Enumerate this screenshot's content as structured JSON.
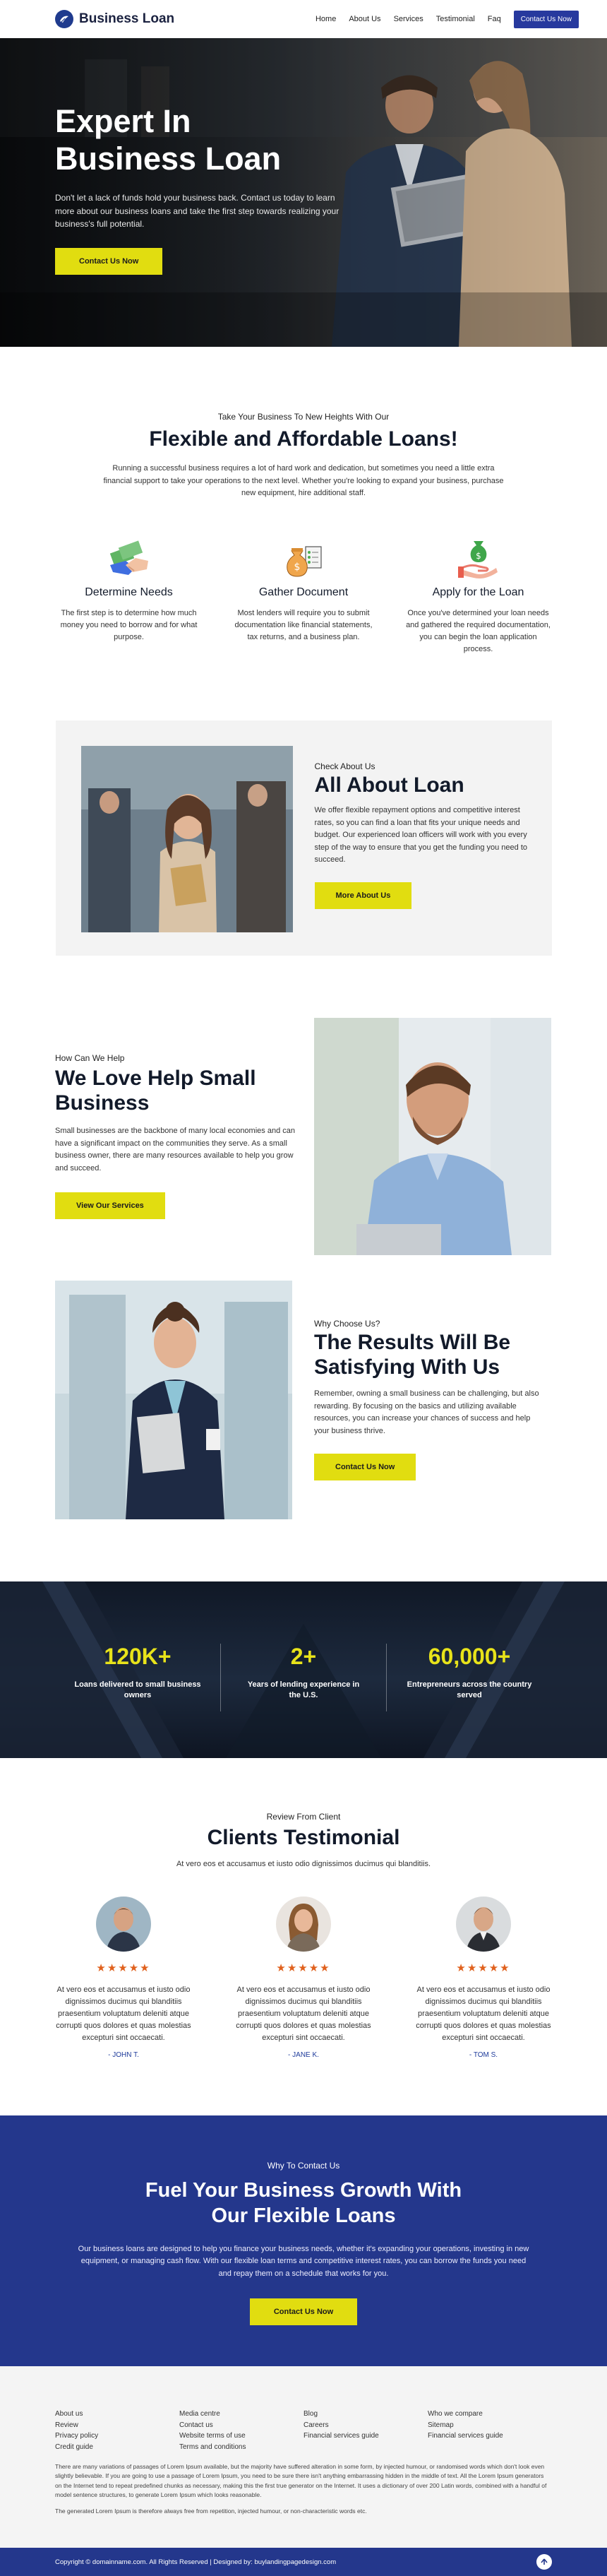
{
  "brand": {
    "name": "Business Loan"
  },
  "nav": {
    "items": [
      "Home",
      "About Us",
      "Services",
      "Testimonial",
      "Faq"
    ],
    "cta": "Contact Us Now"
  },
  "hero": {
    "title_line1": "Expert In",
    "title_line2": "Business Loan",
    "description": "Don't let a lack of funds hold your business back. Contact us today to learn more about our business loans and take the first step towards realizing your business's full potential.",
    "button": "Contact Us Now"
  },
  "flexible": {
    "kicker": "Take Your Business To New Heights With Our",
    "title": "Flexible and Affordable Loans!",
    "description": "Running a successful business requires a lot of hard work and dedication, but sometimes you need a little extra financial support to take your operations to the next level. Whether you're looking to expand your business, purchase new equipment, hire additional staff.",
    "features": [
      {
        "title": "Determine Needs",
        "desc": "The first step is to determine how much money you need to borrow and for what purpose.",
        "icon": "handshake-money-icon"
      },
      {
        "title": "Gather Document",
        "desc": "Most lenders will require you to submit documentation like financial statements, tax returns, and a business plan.",
        "icon": "money-bag-document-icon"
      },
      {
        "title": "Apply for the Loan",
        "desc": "Once you've determined your loan needs and gathered the required documentation, you can begin the loan application process.",
        "icon": "hand-money-icon"
      }
    ]
  },
  "about": {
    "kicker": "Check About Us",
    "title": "All About Loan",
    "description": "We offer flexible repayment options and competitive interest rates, so you can find a loan that fits your unique needs and budget. Our experienced loan officers will work with you every step of the way to ensure that you get the funding you need to succeed.",
    "button": "More About Us"
  },
  "help": {
    "kicker": "How Can We Help",
    "title_line1": "We Love Help Small",
    "title_line2": "Business",
    "description": "Small businesses are the backbone of many local economies and can have a significant impact on the communities they serve. As a small business owner, there are many resources available to help you grow and succeed.",
    "button": "View Our Services"
  },
  "results": {
    "kicker": "Why Choose Us?",
    "title_line1": "The Results Will Be",
    "title_line2": "Satisfying With Us",
    "description": "Remember, owning a small business can be challenging, but also rewarding. By focusing on the basics and utilizing available resources, you can increase your chances of success and help your business thrive.",
    "button": "Contact Us Now"
  },
  "stats": [
    {
      "number": "120K+",
      "label_line1": "Loans delivered to small business",
      "label_line2": "owners"
    },
    {
      "number": "2+",
      "label_line1": "Years of lending experience in",
      "label_line2": "the U.S."
    },
    {
      "number": "60,000+",
      "label_line1": "Entrepreneurs across the country",
      "label_line2": "served"
    }
  ],
  "testimonials": {
    "kicker": "Review From Client",
    "title": "Clients Testimonial",
    "subtitle": "At vero eos et accusamus et iusto odio dignissimos ducimus qui blanditiis.",
    "stars": "★★★★★",
    "items": [
      {
        "text": "At vero eos et accusamus et iusto odio dignissimos ducimus qui blanditiis praesentium voluptatum deleniti atque corrupti quos dolores et quas molestias excepturi sint occaecati.",
        "name": "- JOHN T."
      },
      {
        "text": "At vero eos et accusamus et iusto odio dignissimos ducimus qui blanditiis praesentium voluptatum deleniti atque corrupti quos dolores et quas molestias excepturi sint occaecati.",
        "name": "- JANE K."
      },
      {
        "text": "At vero eos et accusamus et iusto odio dignissimos ducimus qui blanditiis praesentium voluptatum deleniti atque corrupti quos dolores et quas molestias excepturi sint occaecati.",
        "name": "- TOM S."
      }
    ]
  },
  "cta": {
    "kicker": "Why To Contact Us",
    "title_line1": "Fuel Your Business Growth With",
    "title_line2": "Our Flexible Loans",
    "description": "Our business loans are designed to help you finance your business needs, whether it's expanding your operations, investing in new equipment, or managing cash flow. With our flexible loan terms and competitive interest rates, you can borrow the funds you need and repay them on a schedule that works for you.",
    "button": "Contact Us Now"
  },
  "footer": {
    "col1": [
      "About us",
      "Review",
      "Privacy policy",
      "Credit guide"
    ],
    "col2": [
      "Media centre",
      "Contact us",
      "Website terms of use",
      "Terms and conditions"
    ],
    "col3": [
      "Blog",
      "Careers",
      "Financial services guide"
    ],
    "col4": [
      "Who we compare",
      "Sitemap",
      "Financial services guide"
    ],
    "note1": "There are many variations of passages of Lorem Ipsum available, but the majority have suffered alteration in some form, by injected humour, or randomised words which don't look even slightly believable. If you are going to use a passage of Lorem Ipsum, you need to be sure there isn't anything embarrassing hidden in the middle of text. All the Lorem Ipsum generators on the Internet tend to repeat predefined chunks as necessary, making this the first true generator on the Internet. It uses a dictionary of over 200 Latin words, combined with a handful of model sentence structures, to generate Lorem Ipsum which looks reasonable.",
    "note2": "The generated Lorem Ipsum is therefore always free from repetition, injected humour, or non-characteristic words etc.",
    "copyright": "Copyright © domainname.com. All Rights Reserved | Designed by: buylandingpagedesign.com"
  },
  "colors": {
    "primary": "#24378c",
    "accent": "#e1dd10",
    "star": "#e0611d"
  }
}
